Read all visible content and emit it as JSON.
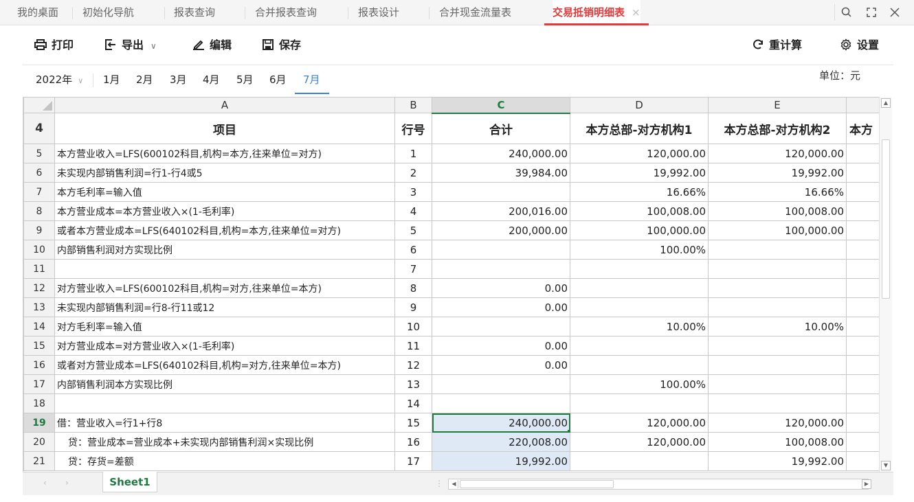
{
  "tabs": [
    {
      "label": "我的桌面"
    },
    {
      "label": "初始化导航"
    },
    {
      "label": "报表查询"
    },
    {
      "label": "合并报表查询"
    },
    {
      "label": "报表设计"
    },
    {
      "label": "合并现金流量表"
    },
    {
      "label": "交易抵销明细表",
      "active": true
    }
  ],
  "tab_close_glyph": "×",
  "window_controls": {
    "search": "search-icon",
    "fullscreen": "fullscreen-icon",
    "close": "close-icon"
  },
  "toolbar": {
    "print": "打印",
    "export": "导出",
    "edit": "编辑",
    "save": "保存",
    "recalc": "重计算",
    "settings": "设置"
  },
  "period": {
    "year": "2022年",
    "months": [
      "1月",
      "2月",
      "3月",
      "4月",
      "5月",
      "6月",
      "7月"
    ],
    "active_month": "7月",
    "unit": "单位：元"
  },
  "sheet": {
    "columns": [
      "A",
      "B",
      "C",
      "D",
      "E"
    ],
    "selected_column": "C",
    "header_row": {
      "row": "4",
      "cells": [
        "项目",
        "行号",
        "合计",
        "本方总部-对方机构1",
        "本方总部-对方机构2",
        "本方"
      ]
    },
    "rows": [
      {
        "row": "5",
        "a": "本方营业收入=LFS(600102科目,机构=本方,往来单位=对方)",
        "b": "1",
        "c": "240,000.00",
        "d": "120,000.00",
        "e": "120,000.00"
      },
      {
        "row": "6",
        "a": "未实现内部销售利润=行1-行4或5",
        "b": "2",
        "c": "39,984.00",
        "d": "19,992.00",
        "e": "19,992.00"
      },
      {
        "row": "7",
        "a": "本方毛利率=输入值",
        "b": "3",
        "c": "",
        "d": "16.66%",
        "e": "16.66%"
      },
      {
        "row": "8",
        "a": "本方营业成本=本方营业收入×(1-毛利率)",
        "b": "4",
        "c": "200,016.00",
        "d": "100,008.00",
        "e": "100,008.00"
      },
      {
        "row": "9",
        "a": "或者本方营业成本=LFS(640102科目,机构=本方,往来单位=对方)",
        "b": "5",
        "c": "200,000.00",
        "d": "100,000.00",
        "e": "100,000.00"
      },
      {
        "row": "10",
        "a": "内部销售利润对方实现比例",
        "b": "6",
        "c": "",
        "d": "100.00%",
        "e": ""
      },
      {
        "row": "11",
        "a": "",
        "b": "7",
        "c": "",
        "d": "",
        "e": ""
      },
      {
        "row": "12",
        "a": "对方营业收入=LFS(600102科目,机构=对方,往来单位=本方)",
        "b": "8",
        "c": "0.00",
        "d": "",
        "e": ""
      },
      {
        "row": "13",
        "a": "未实现内部销售利润=行8-行11或12",
        "b": "9",
        "c": "0.00",
        "d": "",
        "e": ""
      },
      {
        "row": "14",
        "a": "对方毛利率=输入值",
        "b": "10",
        "c": "",
        "d": "10.00%",
        "e": "10.00%"
      },
      {
        "row": "15",
        "a": "对方营业成本=对方营业收入×(1-毛利率)",
        "b": "11",
        "c": "0.00",
        "d": "",
        "e": ""
      },
      {
        "row": "16",
        "a": "或者对方营业成本=LFS(640102科目,机构=对方,往来单位=本方)",
        "b": "12",
        "c": "0.00",
        "d": "",
        "e": ""
      },
      {
        "row": "17",
        "a": "内部销售利润本方实现比例",
        "b": "13",
        "c": "",
        "d": "100.00%",
        "e": ""
      },
      {
        "row": "18",
        "a": "",
        "b": "14",
        "c": "",
        "d": "",
        "e": ""
      },
      {
        "row": "19",
        "a": "借：营业收入=行1+行8",
        "b": "15",
        "c": "240,000.00",
        "d": "120,000.00",
        "e": "120,000.00"
      },
      {
        "row": "20",
        "a": "贷：营业成本=营业成本+未实现内部销售利润×实现比例",
        "b": "16",
        "c": "220,008.00",
        "d": "120,000.00",
        "e": "100,008.00"
      },
      {
        "row": "21",
        "a": "贷：存货=差额",
        "b": "17",
        "c": "19,992.00",
        "d": "",
        "e": "19,992.00"
      }
    ],
    "selected_row": "19",
    "sheet_tab": "Sheet1"
  }
}
